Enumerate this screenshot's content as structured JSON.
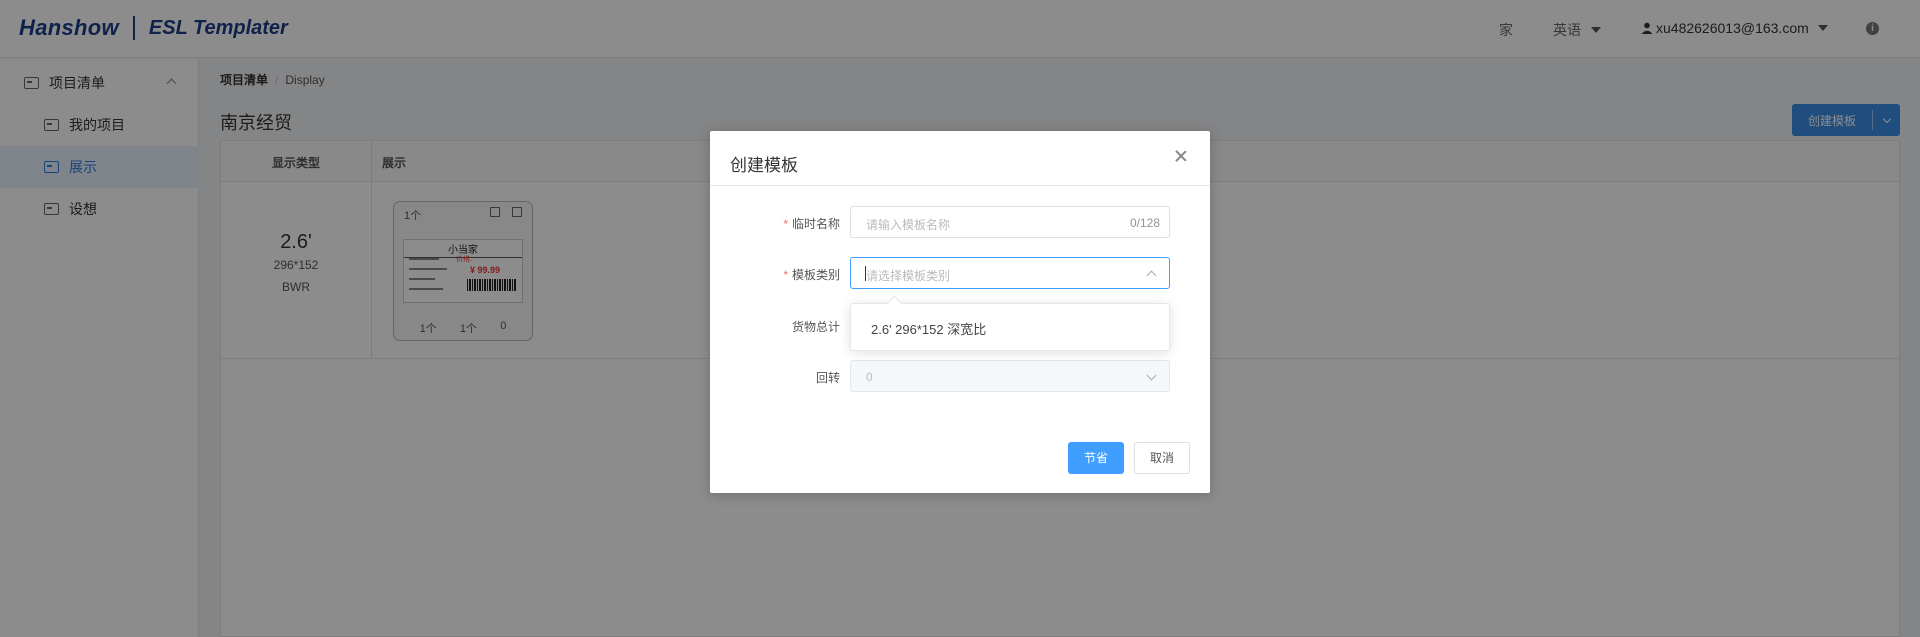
{
  "header": {
    "brand": "Hanshow",
    "product": "ESL Templater",
    "home_label": "家",
    "lang_label": "英语",
    "user_label": "xu482626013@163.com",
    "info_glyph": "i"
  },
  "sidebar": {
    "group_label": "项目清单",
    "items": [
      {
        "label": "我的项目"
      },
      {
        "label": "展示"
      },
      {
        "label": "设想"
      }
    ]
  },
  "breadcrumb": {
    "root": "项目清单",
    "sep": "/",
    "current": "Display"
  },
  "page": {
    "title": "南京经贸",
    "create_button": "创建模板"
  },
  "table": {
    "headers": [
      "显示类型",
      "展示"
    ],
    "row": {
      "size": "2.6'",
      "resolution": "296*152",
      "color": "BWR"
    },
    "card": {
      "count": "1个",
      "label_title": "小当家",
      "label_red": "价格:",
      "label_price": "¥ 99.99",
      "foot": [
        "1个",
        "1个",
        "0"
      ]
    }
  },
  "modal": {
    "title": "创建模板",
    "fields": {
      "name_label": "临时名称",
      "name_placeholder": "请输入模板名称",
      "name_counter": "0/128",
      "category_label": "模板类别",
      "category_placeholder": "请选择模板类别",
      "goods_label": "货物总计",
      "rotate_label": "回转",
      "rotate_value": "0"
    },
    "dropdown_options": [
      "2.6' 296*152 深宽比"
    ],
    "save_button": "节省",
    "cancel_button": "取消"
  },
  "colors": {
    "primary": "#409eff",
    "brand": "#1d3f8a",
    "required": "#f56c6c",
    "sidebar_active": "#2d7be0"
  }
}
